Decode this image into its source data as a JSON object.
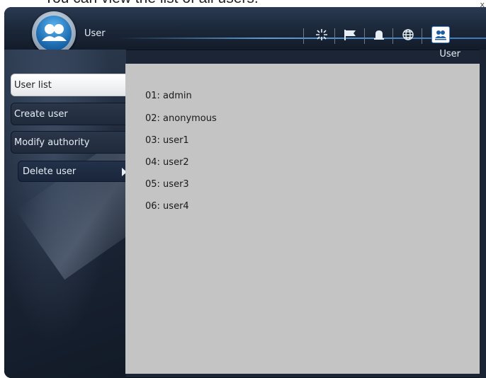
{
  "caption": "You can view the list of all users.",
  "corner_mark": "x",
  "app": {
    "title": "User",
    "section_label": "User"
  },
  "toolbar": [
    {
      "name": "settings-burst-icon",
      "active": false
    },
    {
      "name": "flag-icon",
      "active": false
    },
    {
      "name": "alarm-bell-icon",
      "active": false
    },
    {
      "name": "globe-icon",
      "active": false
    },
    {
      "name": "users-icon",
      "active": true
    }
  ],
  "sidebar": {
    "items": [
      {
        "label": "User list",
        "active": true
      },
      {
        "label": "Create user",
        "active": false
      },
      {
        "label": "Modify authority",
        "active": false
      },
      {
        "label": "Delete user",
        "active": false,
        "sub": true
      }
    ]
  },
  "users": [
    "01: admin",
    "02: anonymous",
    "03: user1",
    "04: user2",
    "05: user3",
    "06: user4"
  ],
  "colors": {
    "accent": "#4a86c4",
    "content_bg": "#c4c4c4",
    "header_bg": "#1d2a3d"
  }
}
